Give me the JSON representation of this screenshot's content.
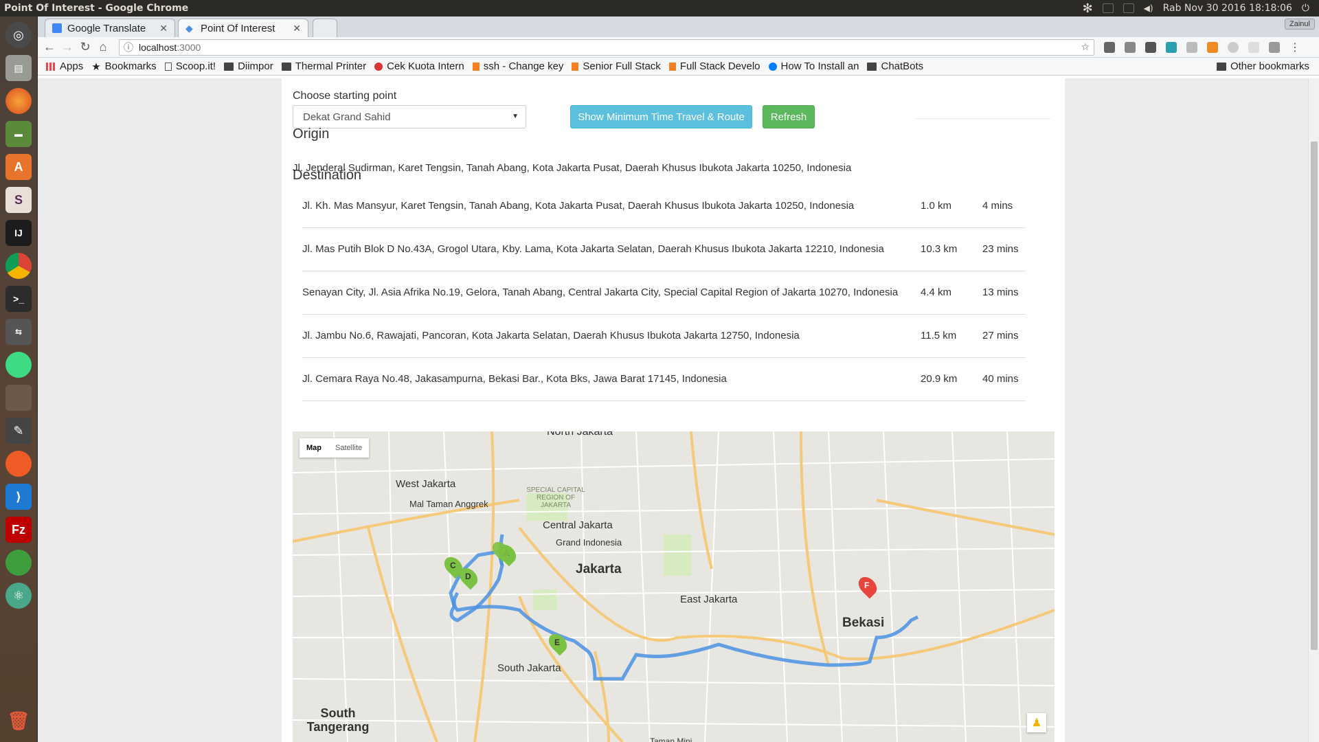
{
  "os_panel": {
    "window_title": "Point Of Interest - Google Chrome",
    "datetime": "Rab Nov 30 2016 18:18:06"
  },
  "browser": {
    "profile": "Zainul",
    "tabs": [
      {
        "label": "Google Translate"
      },
      {
        "label": "Point Of Interest"
      }
    ],
    "url_host": "localhost",
    "url_port": ":3000",
    "bookmarks": [
      "Apps",
      "Bookmarks",
      "Scoop.it!",
      "Diimpor",
      "Thermal Printer",
      "Cek Kuota Intern",
      "ssh - Change key",
      "Senior Full Stack",
      "Full Stack Develo",
      "How To Install an",
      "ChatBots"
    ],
    "other_bookmarks": "Other bookmarks"
  },
  "page": {
    "start_label": "Choose starting point",
    "start_selected": "Dekat Grand Sahid",
    "show_button": "Show Minimum Time Travel & Route",
    "refresh_button": "Refresh",
    "origin_heading": "Origin",
    "origin_address": "Jl. Jenderal Sudirman, Karet Tengsin, Tanah Abang, Kota Jakarta Pusat, Daerah Khusus Ibukota Jakarta 10250, Indonesia",
    "destination_heading": "Destination",
    "destinations": [
      {
        "address": "Jl. Kh. Mas Mansyur, Karet Tengsin, Tanah Abang, Kota Jakarta Pusat, Daerah Khusus Ibukota Jakarta 10250, Indonesia",
        "distance": "1.0 km",
        "time": "4 mins"
      },
      {
        "address": "Jl. Mas Putih Blok D No.43A, Grogol Utara, Kby. Lama, Kota Jakarta Selatan, Daerah Khusus Ibukota Jakarta 12210, Indonesia",
        "distance": "10.3 km",
        "time": "23 mins"
      },
      {
        "address": "Senayan City, Jl. Asia Afrika No.19, Gelora, Tanah Abang, Central Jakarta City, Special Capital Region of Jakarta 10270, Indonesia",
        "distance": "4.4 km",
        "time": "13 mins"
      },
      {
        "address": "Jl. Jambu No.6, Rawajati, Pancoran, Kota Jakarta Selatan, Daerah Khusus Ibukota Jakarta 12750, Indonesia",
        "distance": "11.5 km",
        "time": "27 mins"
      },
      {
        "address": "Jl. Cemara Raya No.48, Jakasampurna, Bekasi Bar., Kota Bks, Jawa Barat 17145, Indonesia",
        "distance": "20.9 km",
        "time": "40 mins"
      }
    ]
  },
  "map": {
    "type_map": "Map",
    "type_satellite": "Satellite",
    "labels": {
      "north_jakarta": "North Jakarta",
      "west_jakarta": "West Jakarta",
      "mal_taman_anggrek": "Mal Taman Anggrek",
      "special_capital": "SPECIAL CAPITAL REGION OF JAKARTA",
      "central_jakarta": "Central Jakarta",
      "grand_indonesia": "Grand Indonesia",
      "jakarta": "Jakarta",
      "east_jakarta": "East Jakarta",
      "bekasi": "Bekasi",
      "south_jakarta": "South Jakarta",
      "south_tangerang": "South Tangerang",
      "taman_mini": "Taman Mini"
    },
    "markers": [
      "A",
      "B",
      "C",
      "D",
      "E",
      "F"
    ],
    "route_color": "#4a90e2",
    "marker_green": "#7cc242",
    "marker_red": "#e8453c"
  }
}
